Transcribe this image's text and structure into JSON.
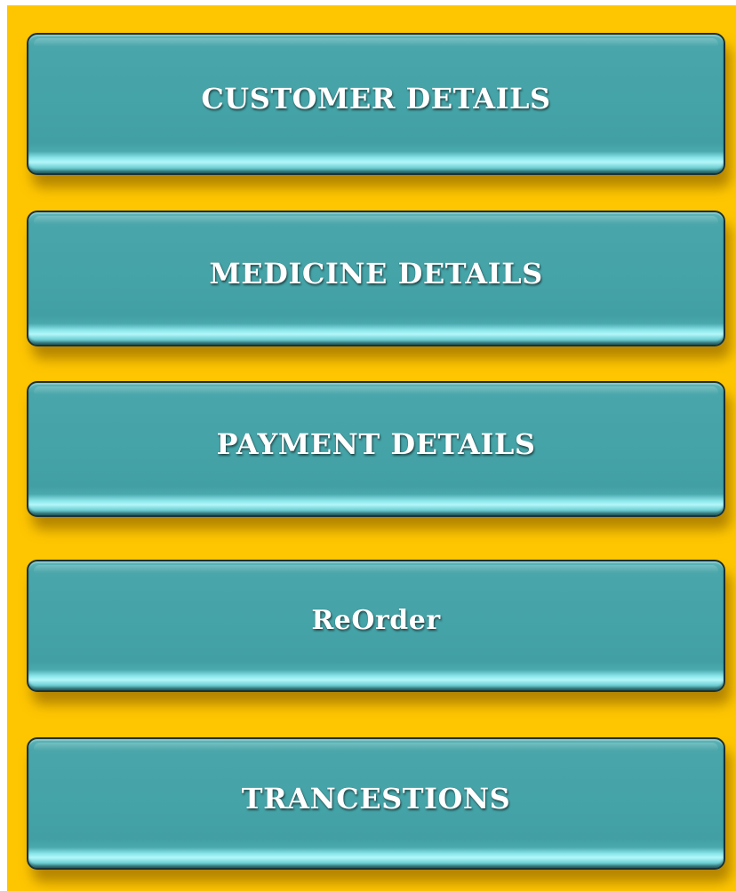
{
  "menu": {
    "items": [
      {
        "label": "CUSTOMER DETAILS"
      },
      {
        "label": "MEDICINE DETAILS"
      },
      {
        "label": "PAYMENT DETAILS"
      },
      {
        "label": "ReOrder"
      },
      {
        "label": "TRANCESTIONS"
      }
    ]
  },
  "colors": {
    "background": "#fec601",
    "button": "#44a3a7",
    "button_highlight": "#b3f7fa",
    "border": "#1b3236",
    "text": "#ffffff"
  }
}
